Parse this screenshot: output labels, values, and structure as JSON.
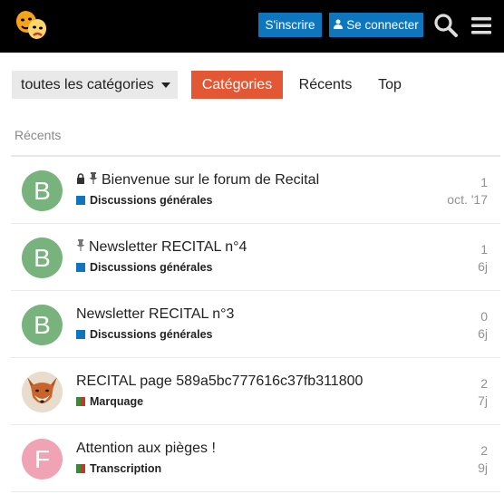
{
  "header": {
    "logo": "theatre-masks-logo",
    "signup_label": "S'inscrire",
    "login_label": "Se connecter",
    "colors": {
      "bar": "#000000",
      "button": "#0e76bd"
    }
  },
  "nav": {
    "category_dropdown": "toutes les catégories",
    "tabs": [
      {
        "label": "Catégories",
        "active": true
      },
      {
        "label": "Récents",
        "active": false
      },
      {
        "label": "Top",
        "active": false
      }
    ],
    "active_color": "#e45735"
  },
  "section_label": "Récents",
  "topics": [
    {
      "avatar_letter": "B",
      "avatar_color": "#78b27c",
      "locked": true,
      "pinned": true,
      "title": "Bienvenue sur le forum de Recital",
      "category": "Discussions générales",
      "category_color": "#0e76bd",
      "replies": "1",
      "activity": "oct. '17"
    },
    {
      "avatar_letter": "B",
      "avatar_color": "#78b27c",
      "locked": false,
      "pinned": true,
      "title": "Newsletter RECITAL n°4",
      "category": "Discussions générales",
      "category_color": "#0e76bd",
      "replies": "1",
      "activity": "6j"
    },
    {
      "avatar_letter": "B",
      "avatar_color": "#78b27c",
      "locked": false,
      "pinned": false,
      "title": "Newsletter RECITAL n°3",
      "category": "Discussions générales",
      "category_color": "#0e76bd",
      "replies": "0",
      "activity": "6j"
    },
    {
      "avatar_letter": "",
      "avatar_color": "#d9c7b3",
      "locked": false,
      "pinned": false,
      "title": "RECITAL page 589a5bc777616c37fb311800",
      "category": "Marquage",
      "category_color": "#3b8a3a",
      "replies": "2",
      "activity": "7j"
    },
    {
      "avatar_letter": "F",
      "avatar_color": "#f0a3b5",
      "locked": false,
      "pinned": false,
      "title": "Attention aux pièges !",
      "category": "Transcription",
      "category_color": "#3b8a3a",
      "replies": "2",
      "activity": "9j"
    }
  ]
}
